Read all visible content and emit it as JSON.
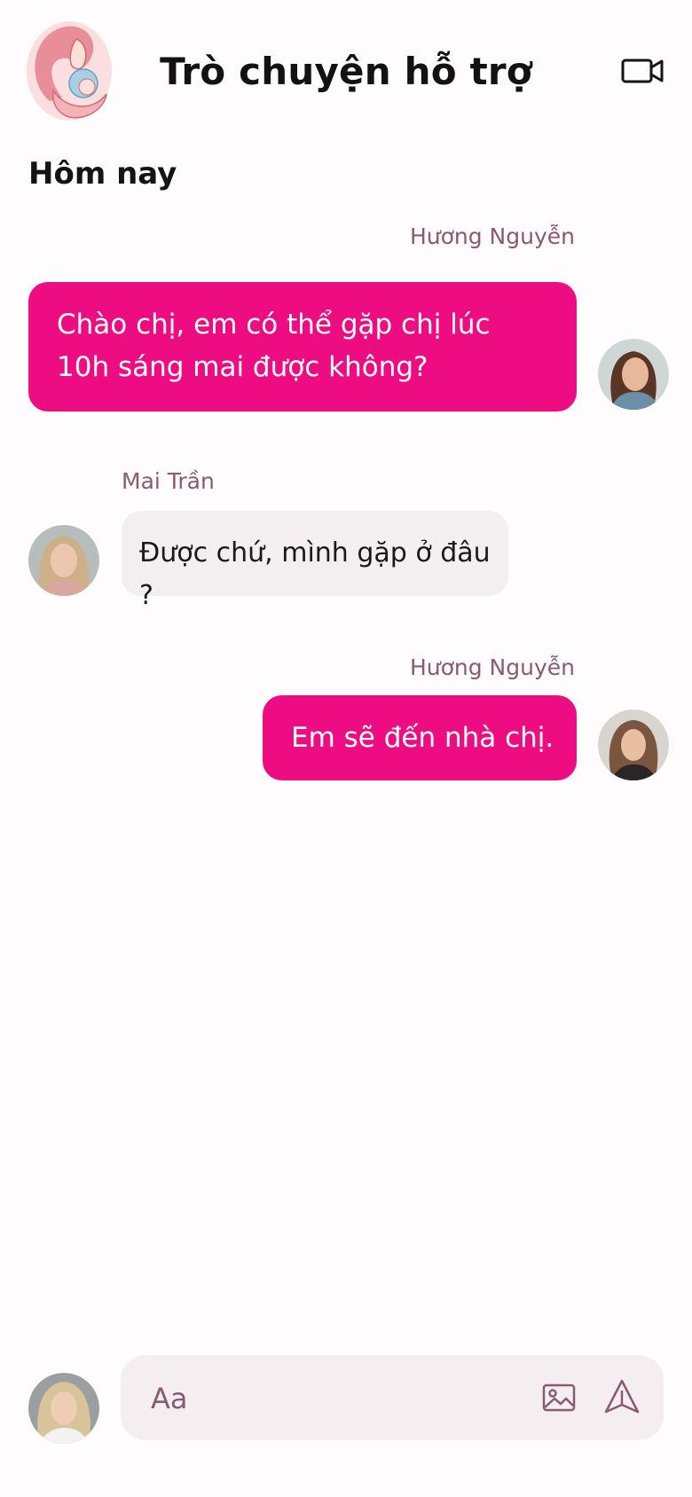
{
  "header": {
    "title": "Trò chuyện hỗ trợ",
    "logo_icon": "mother-baby-logo-icon",
    "video_icon": "video-camera-icon"
  },
  "date_label": "Hôm nay",
  "messages": [
    {
      "sender": "Hương Nguyễn",
      "text_lines": [
        "Chào chị, em có thể gặp chị lúc",
        "10h sáng mai được không?"
      ],
      "direction": "outgoing"
    },
    {
      "sender": "Mai Trần",
      "text": "Được chứ, mình gặp ở đâu ?",
      "direction": "incoming"
    },
    {
      "sender": "Hương Nguyễn",
      "text": "Em sẽ đến nhà chị.",
      "direction": "outgoing"
    }
  ],
  "composer": {
    "placeholder": "Aa",
    "image_icon": "image-icon",
    "send_icon": "send-icon"
  },
  "colors": {
    "accent": "#ee0c82",
    "incoming_bubble": "#f3eff1",
    "sender_name": "#8a5a70",
    "background": "#fffcfd"
  }
}
